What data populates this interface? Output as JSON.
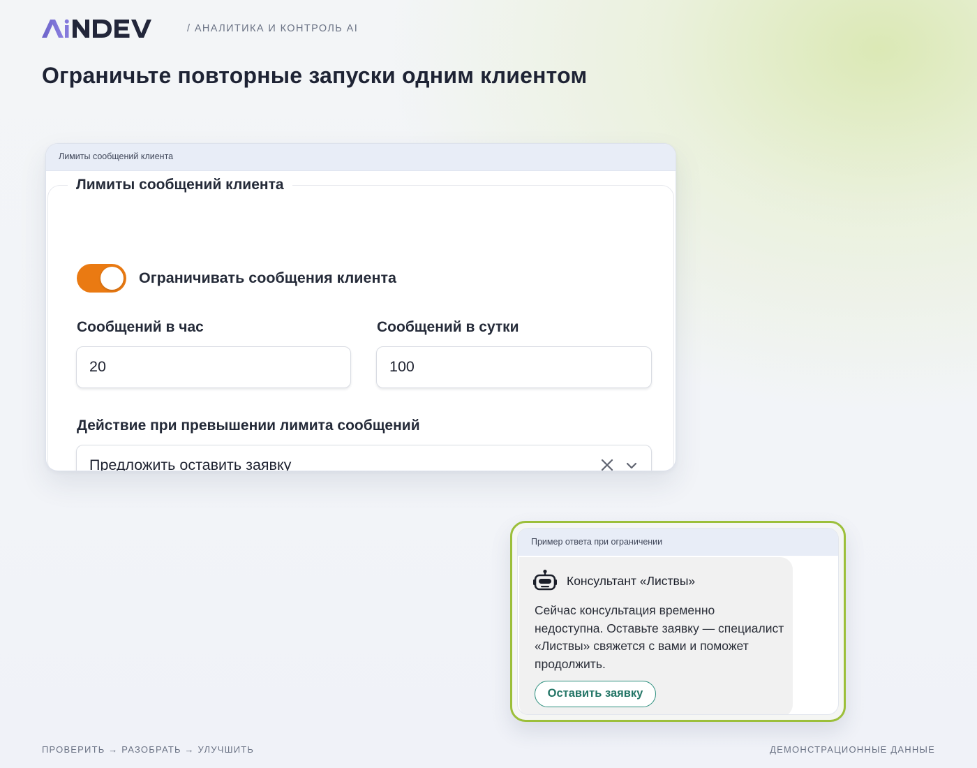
{
  "header": {
    "logo_text": "AiNDEV",
    "breadcrumb": "/ АНАЛИТИКА И КОНТРОЛЬ AI",
    "title": "Ограничьте повторные запуски одним клиентом"
  },
  "settings_card": {
    "window_title": "Лимиты сообщений клиента",
    "section_title": "Лимиты сообщений клиента",
    "toggle": {
      "label": "Ограничивать сообщения клиента",
      "checked": true,
      "color": "#ea7a12"
    },
    "per_hour": {
      "label": "Сообщений в час",
      "value": "20"
    },
    "per_day": {
      "label": "Сообщений в сутки",
      "value": "100"
    },
    "action": {
      "label": "Действие при превышении лимита сообщений",
      "value": "Предложить оставить заявку",
      "clear_icon": "close-icon",
      "dropdown_icon": "chevron-down-icon"
    }
  },
  "preview_card": {
    "window_title": "Пример ответа при ограничении",
    "border_color": "#9cbf3a",
    "bot_name": "Консультант «Листвы»",
    "bot_icon": "robot-icon",
    "message": "Сейчас консультация временно недоступна. Оставьте заявку — специалист «Листвы» свяжется с вами и поможет продолжить.",
    "button_label": "Оставить заявку"
  },
  "footer": {
    "left": "ПРОВЕРИТЬ → РАЗОБРАТЬ → УЛУЧШИТЬ",
    "right": "ДЕМОНСТРАЦИОННЫЕ ДАННЫЕ"
  }
}
